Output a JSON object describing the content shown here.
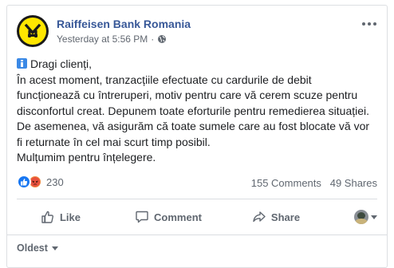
{
  "post": {
    "page_name": "Raiffeisen Bank Romania",
    "timestamp": "Yesterday at 5:56 PM",
    "separator": "·",
    "privacy_icon": "globe-icon",
    "body_lines": [
      "Dragi clienți,",
      "În acest moment, tranzacțiile efectuate cu cardurile de debit",
      "funcționează cu întreruperi, motiv pentru care vă cerem scuze pentru",
      "disconfortul creat. Depunem toate eforturile pentru remedierea situației.",
      "De asemenea, vă asigurăm că toate sumele care au fost blocate vă vor",
      "fi returnate în cel mai scurt timp posibil.",
      "Mulțumim pentru înțelegere."
    ],
    "leading_icon": "info-icon"
  },
  "stats": {
    "reactions": [
      "like",
      "angry"
    ],
    "reaction_count": "230",
    "comments": "155 Comments",
    "shares": "49 Shares"
  },
  "actions": {
    "like": "Like",
    "comment": "Comment",
    "share": "Share"
  },
  "comments_sort": {
    "label": "Oldest"
  },
  "colors": {
    "link_blue": "#385898",
    "brand_yellow": "#ffe600",
    "like_blue": "#1877f2",
    "angry_orange": "#f0883e",
    "muted_text": "#606770"
  }
}
